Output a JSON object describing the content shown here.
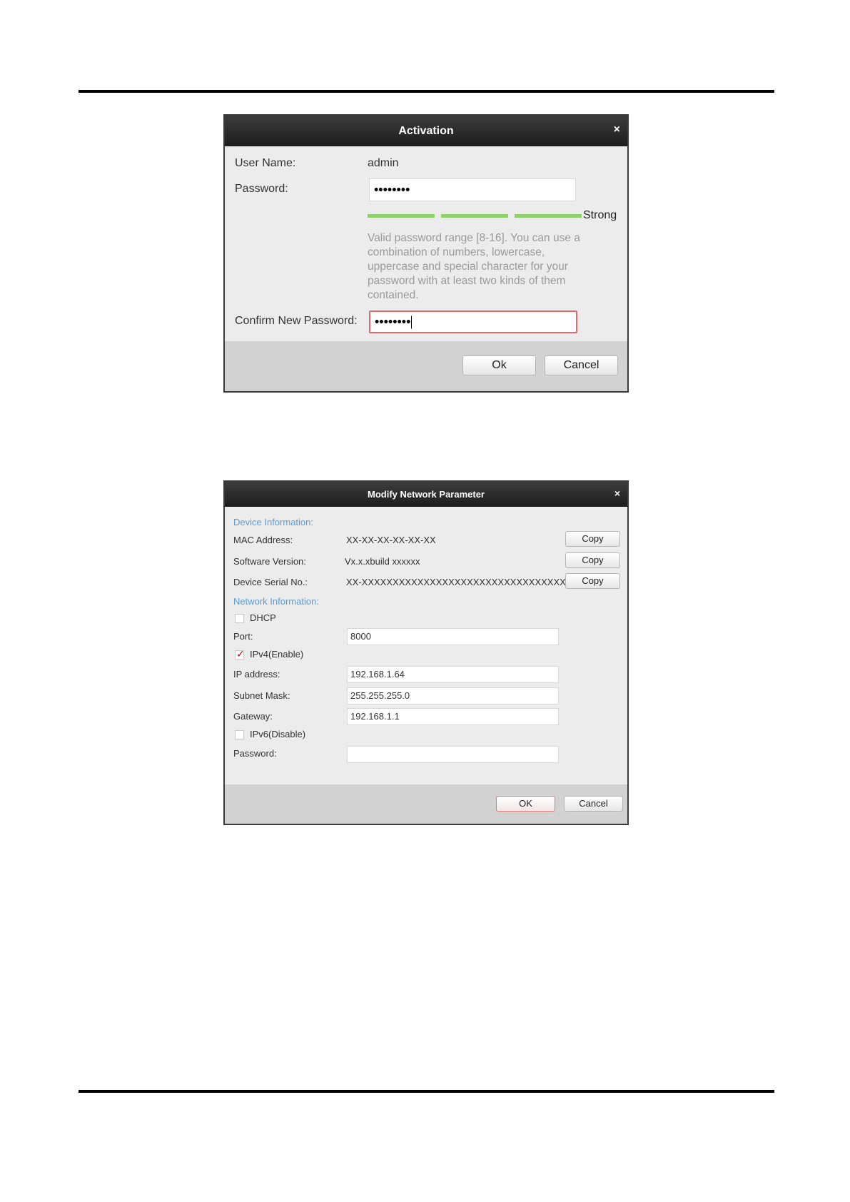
{
  "activation": {
    "title": "Activation",
    "close": "×",
    "user_name_label": "User Name:",
    "user_name_value": "admin",
    "password_label": "Password:",
    "password_value": "••••••••",
    "strength_label": "Strong",
    "strength_color": "#8fd16a",
    "hint": "Valid password range [8-16]. You can use a combination of numbers, lowercase, uppercase and special character for your password with at least two kinds of them contained.",
    "confirm_label": "Confirm New Password:",
    "confirm_value": "••••••••",
    "ok_label": "Ok",
    "cancel_label": "Cancel"
  },
  "network": {
    "title": "Modify Network Parameter",
    "close": "×",
    "device_info_heading": "Device Information:",
    "mac_label": "MAC Address:",
    "mac_value": "XX-XX-XX-XX-XX-XX",
    "software_label": "Software Version:",
    "software_value": "Vx.x.xbuild xxxxxx",
    "serial_label": "Device Serial No.:",
    "serial_value": "XX-XXXXXXXXXXXXXXXXXXXXXXXXXXXXXXXXXXX",
    "copy_label": "Copy",
    "network_info_heading": "Network Information:",
    "dhcp_label": "DHCP",
    "dhcp_checked": false,
    "port_label": "Port:",
    "port_value": "8000",
    "ipv4_label": "IPv4(Enable)",
    "ipv4_checked": true,
    "ip_label": "IP address:",
    "ip_value": "192.168.1.64",
    "subnet_label": "Subnet Mask:",
    "subnet_value": "255.255.255.0",
    "gateway_label": "Gateway:",
    "gateway_value": "192.168.1.1",
    "ipv6_label": "IPv6(Disable)",
    "ipv6_checked": false,
    "password_label": "Password:",
    "password_value": "",
    "ok_label": "OK",
    "cancel_label": "Cancel",
    "section_color": "#5b9bd5"
  }
}
